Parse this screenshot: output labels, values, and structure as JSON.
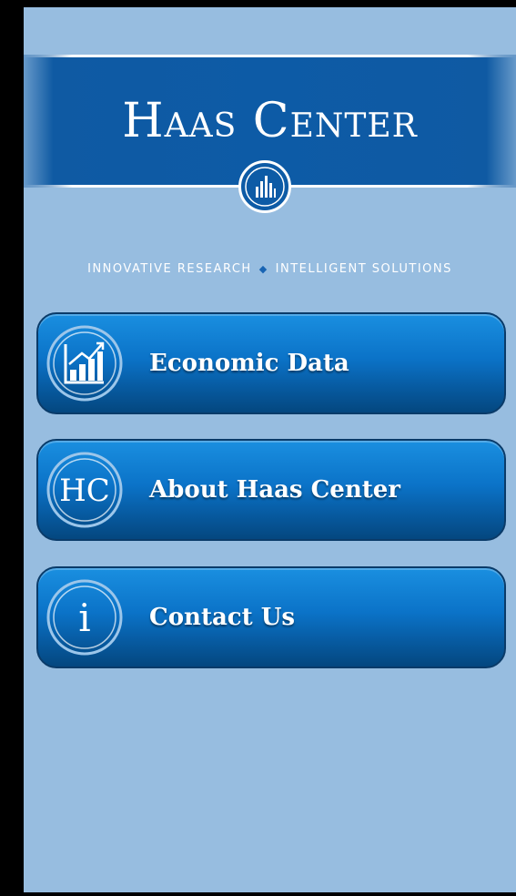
{
  "header": {
    "title": "Haas Center",
    "tagline_left": "INNOVATIVE RESEARCH",
    "tagline_separator": "◆",
    "tagline_right": "INTELLIGENT SOLUTIONS",
    "logo_icon": "bar-chart-seal-icon"
  },
  "menu": {
    "items": [
      {
        "label": "Economic Data",
        "icon": "growth-chart-icon"
      },
      {
        "label": "About Haas Center",
        "icon": "hc-monogram-icon",
        "icon_text": "HC"
      },
      {
        "label": "Contact Us",
        "icon": "info-icon",
        "icon_text": "i"
      }
    ]
  },
  "colors": {
    "background": "#97bde0",
    "banner": "#0d5ba6",
    "button_top": "#1a8fe0",
    "button_bottom": "#04477f",
    "text": "#ffffff"
  }
}
